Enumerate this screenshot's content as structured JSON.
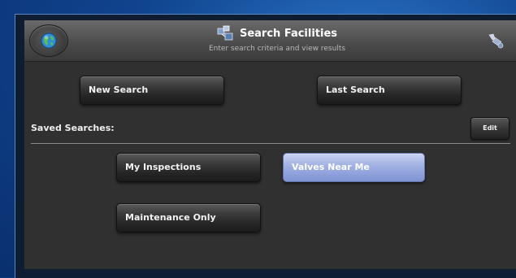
{
  "header": {
    "title": "Search Facilities",
    "subtitle": "Enter search criteria and view results",
    "left_icon": "globe-icon",
    "title_icon": "search-facilities-icon",
    "right_icon": "settings-icon"
  },
  "actions": {
    "new_search": "New Search",
    "last_search": "Last Search"
  },
  "saved_searches": {
    "label": "Saved Searches:",
    "edit": "Edit",
    "items": [
      {
        "label": "My Inspections",
        "selected": false
      },
      {
        "label": "Valves Near Me",
        "selected": true
      },
      {
        "label": "Maintenance Only",
        "selected": false
      }
    ]
  },
  "colors": {
    "background": "#10448f",
    "panel": "#303030",
    "selected": "#9fb0e2"
  }
}
